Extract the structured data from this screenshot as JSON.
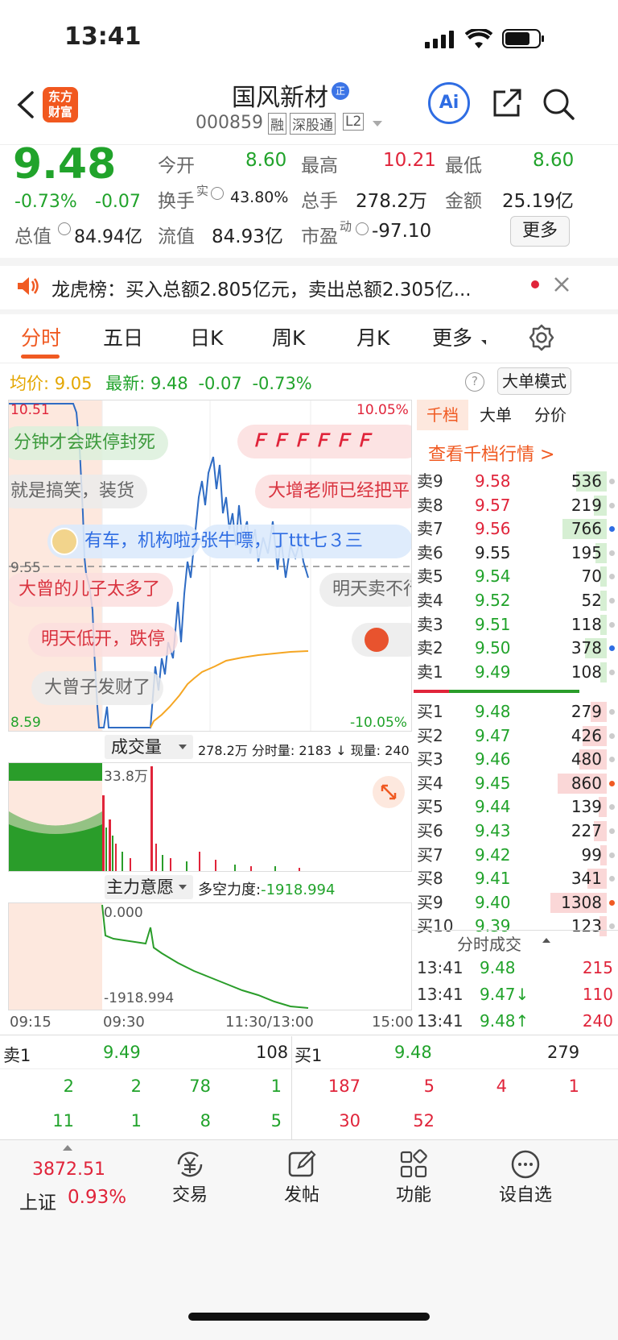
{
  "status": {
    "time": "13:41"
  },
  "header": {
    "title": "国风新材",
    "code": "000859",
    "tags": [
      "融",
      "深股通",
      "L2"
    ],
    "badge": "正",
    "logo": "东方\n财富",
    "ai": "Ai"
  },
  "quote": {
    "price": "9.48",
    "pct": "-0.73%",
    "chg": "-0.07",
    "r1": [
      [
        "今开",
        "8.60"
      ],
      [
        "最高",
        "10.21"
      ],
      [
        "最低",
        "8.60"
      ]
    ],
    "r2": [
      [
        "换手",
        "43.80%"
      ],
      [
        "总手",
        "278.2万"
      ],
      [
        "金额",
        "25.19亿"
      ]
    ],
    "r2sup": "实",
    "r3": [
      [
        "总值",
        "84.94亿"
      ],
      [
        "流值",
        "84.93亿"
      ],
      [
        "市盈",
        "-97.10"
      ]
    ],
    "r3sup": "动",
    "more": "更多"
  },
  "notice": {
    "text": "龙虎榜：买入总额2.805亿元，卖出总额2.305亿..."
  },
  "tabs": [
    "分时",
    "五日",
    "日K",
    "周K",
    "月K",
    "更多"
  ],
  "info": {
    "avg_label": "均价:",
    "avg": "9.05",
    "last_label": "最新:",
    "last": "9.48",
    "chg": "-0.07",
    "pct": "-0.73%",
    "mode": "大单模式"
  },
  "chart": {
    "ymax": "10.51",
    "ymin": "8.59",
    "pmax": "10.05%",
    "pmin": "-10.05%",
    "mid": "9.55",
    "vol_label": "成交量",
    "vol_info": "278.2万 分时量: 2183 ↓ 现量: 240",
    "vol_max": "33.8万",
    "ind_label": "主力意愿",
    "ind_info_label": "多空力度:",
    "ind_info": "-1918.994",
    "ind_top": "0.000",
    "ind_bot": "-1918.994",
    "xticks": [
      "09:15",
      "09:30",
      "11:30/13:00",
      "15:00"
    ]
  },
  "danmu": [
    "分钟才会跌停封死",
    "就是搞笑，装货",
    "有车，机构啦升",
    "张牛嘌，丁ttt七３三",
    "大曾的儿子太多了",
    "明天低开，跌停",
    "大曾子发财了",
    "大增老师已经把平",
    "明天卖不行",
    "ＦＦＦＦＦＦ"
  ],
  "ob": {
    "tabs": [
      "千档",
      "大单",
      "分价"
    ],
    "link": "查看千档行情 >",
    "asks": [
      [
        "卖9",
        "9.58",
        "536"
      ],
      [
        "卖8",
        "9.57",
        "219"
      ],
      [
        "卖7",
        "9.56",
        "766"
      ],
      [
        "卖6",
        "9.55",
        "195"
      ],
      [
        "卖5",
        "9.54",
        "70"
      ],
      [
        "卖4",
        "9.52",
        "52"
      ],
      [
        "卖3",
        "9.51",
        "118"
      ],
      [
        "卖2",
        "9.50",
        "378"
      ],
      [
        "卖1",
        "9.49",
        "108"
      ]
    ],
    "bids": [
      [
        "买1",
        "9.48",
        "279"
      ],
      [
        "买2",
        "9.47",
        "426"
      ],
      [
        "买3",
        "9.46",
        "480"
      ],
      [
        "买4",
        "9.45",
        "860"
      ],
      [
        "买5",
        "9.44",
        "139"
      ],
      [
        "买6",
        "9.43",
        "227"
      ],
      [
        "买7",
        "9.42",
        "99"
      ],
      [
        "买8",
        "9.41",
        "341"
      ],
      [
        "买9",
        "9.40",
        "1308"
      ],
      [
        "买10",
        "9.39",
        "123"
      ]
    ],
    "ticks_title": "分时成交",
    "ticks": [
      [
        "13:41",
        "9.48",
        "215"
      ],
      [
        "13:41",
        "9.47↓",
        "110"
      ],
      [
        "13:41",
        "9.48↑",
        "240"
      ]
    ]
  },
  "l2": {
    "sell_label": "卖1",
    "sell_price": "9.49",
    "sell_vol": "108",
    "buy_label": "买1",
    "buy_price": "9.48",
    "buy_vol": "279",
    "sell_q": [
      [
        "2",
        "2",
        "78",
        "1"
      ],
      [
        "11",
        "1",
        "8",
        "5"
      ]
    ],
    "buy_q": [
      [
        "187",
        "5",
        "4",
        "1"
      ],
      [
        "30",
        "52"
      ]
    ]
  },
  "bottom": {
    "index": "3872.51",
    "index_name": "上证",
    "index_pct": "0.93%",
    "items": [
      "交易",
      "发帖",
      "功能",
      "设自选"
    ]
  }
}
